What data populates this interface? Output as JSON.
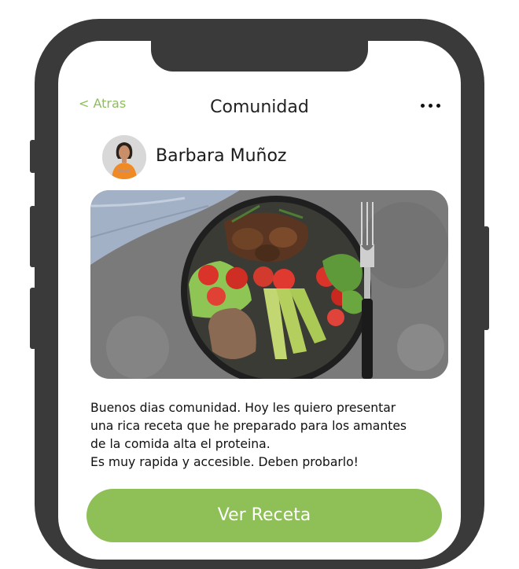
{
  "nav": {
    "back_label": "< Atras",
    "title": "Comunidad"
  },
  "post": {
    "author_name": "Barbara Muñoz",
    "lines": [
      "Buenos dias comunidad. Hoy les quiero presentar",
      "una rica receta que he preparado para los amantes",
      "de la comida alta el proteina.",
      "Es muy rapida y accesible. Deben probarlo!"
    ],
    "image": "food-bowl-photo"
  },
  "actions": {
    "cta_label": "Ver Receta"
  },
  "colors": {
    "accent": "#8fbf57",
    "frame": "#3a3a3a"
  },
  "icons": {
    "more": "more-options-icon"
  }
}
